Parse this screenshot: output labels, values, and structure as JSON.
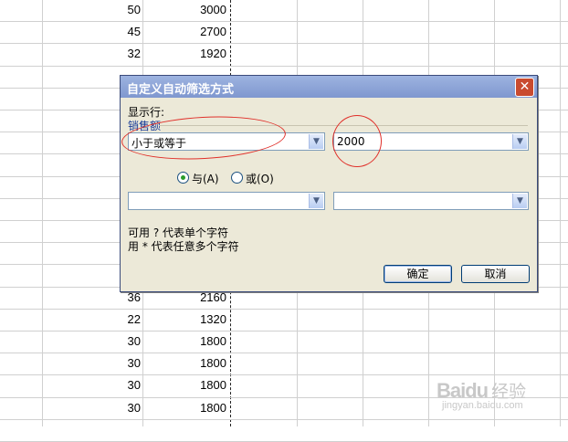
{
  "sheet": {
    "rows": [
      {
        "qty": "50",
        "amount": "3000"
      },
      {
        "qty": "45",
        "amount": "2700"
      },
      {
        "qty": "32",
        "amount": "1920"
      },
      {
        "qty": "",
        "amount": ""
      },
      {
        "qty": "",
        "amount": ""
      },
      {
        "qty": "",
        "amount": ""
      },
      {
        "qty": "",
        "amount": ""
      },
      {
        "qty": "",
        "amount": ""
      },
      {
        "qty": "",
        "amount": ""
      },
      {
        "qty": "",
        "amount": ""
      },
      {
        "qty": "",
        "amount": ""
      },
      {
        "qty": "",
        "amount": ""
      },
      {
        "qty": "",
        "amount": ""
      },
      {
        "qty": "36",
        "amount": "2160"
      },
      {
        "qty": "22",
        "amount": "1320"
      },
      {
        "qty": "30",
        "amount": "1800"
      },
      {
        "qty": "30",
        "amount": "1800"
      },
      {
        "qty": "30",
        "amount": "1800"
      },
      {
        "qty": "30",
        "amount": "1800"
      }
    ]
  },
  "dialog": {
    "title": "自定义自动筛选方式",
    "show_rows_label": "显示行:",
    "field_name": "销售额",
    "condition1": {
      "operator": "小于或等于",
      "value": "2000"
    },
    "condition2": {
      "operator": "",
      "value": ""
    },
    "logic": {
      "and_label": "与(A)",
      "or_label": "或(O)",
      "selected": "and"
    },
    "hint1": "可用 ? 代表单个字符",
    "hint2": "用 * 代表任意多个字符",
    "ok_label": "确定",
    "cancel_label": "取消"
  },
  "watermark": {
    "logo": "Baidu",
    "cn": "经验",
    "url": "jingyan.baidu.com"
  },
  "colors": {
    "annotation": "#e0302a",
    "title_bar": "#7f97cf"
  }
}
